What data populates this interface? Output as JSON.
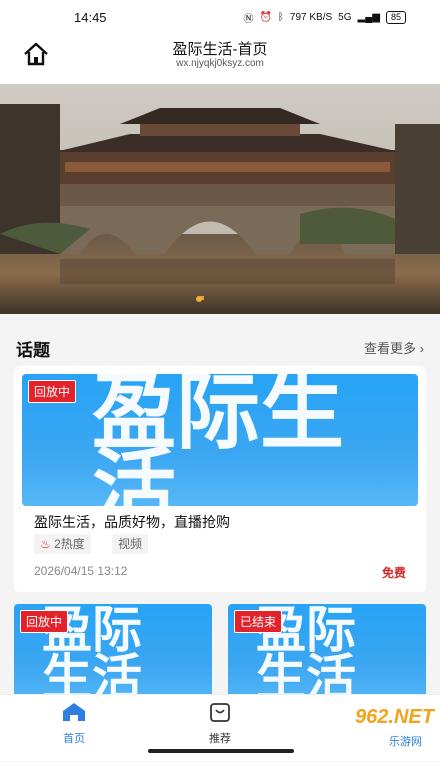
{
  "status": {
    "time": "14:45",
    "net": "797 KB/S",
    "signal": "5G",
    "battery": "85"
  },
  "header": {
    "title": "盈际生活-首页",
    "subtitle": "wx.njyqkj0ksyz.com"
  },
  "section": {
    "title": "话题",
    "more": "查看更多"
  },
  "card": {
    "badge": "回放中",
    "thumb_text": "盈际生活",
    "title": "盈际生活，品质好物，直播抢购",
    "heat": "2热度",
    "tag": "视频",
    "date": "2026/04/15 13:12",
    "price": "免费"
  },
  "card2": {
    "badge": "回放中",
    "thumb_text": "盈际生活"
  },
  "card3": {
    "badge": "已结束",
    "thumb_text": "盈际生活"
  },
  "tabs": [
    {
      "label": "首页",
      "active": true
    },
    {
      "label": "推荐",
      "active": false
    }
  ],
  "watermark": {
    "main": "962.NET",
    "sub": "乐游网"
  },
  "colors": {
    "accent": "#2f7fe0",
    "badge": "#e3232c",
    "price": "#d62a2a",
    "thumb": "#3ba6f2"
  }
}
